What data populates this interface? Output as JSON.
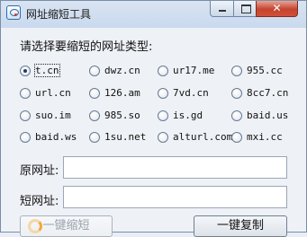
{
  "window": {
    "title": "网址缩短工具"
  },
  "prompt": "请选择要缩短的网址类型:",
  "options": [
    "t.cn",
    "dwz.cn",
    "ur17.me",
    "955.cc",
    "url.cn",
    "126.am",
    "7vd.cn",
    "8cc7.cn",
    "suo.im",
    "985.so",
    "is.gd",
    "baid.us",
    "baid.ws",
    "1su.net",
    "alturl.com",
    "mxi.cc"
  ],
  "selected_option": "t.cn",
  "original_url": {
    "label": "原网址:",
    "value": ""
  },
  "short_url": {
    "label": "短网址:",
    "value": ""
  },
  "buttons": {
    "shorten": "一键缩短",
    "copy": "一键复制"
  },
  "icons": {
    "app": "app-link-icon",
    "loading": "loading-spinner-icon"
  }
}
